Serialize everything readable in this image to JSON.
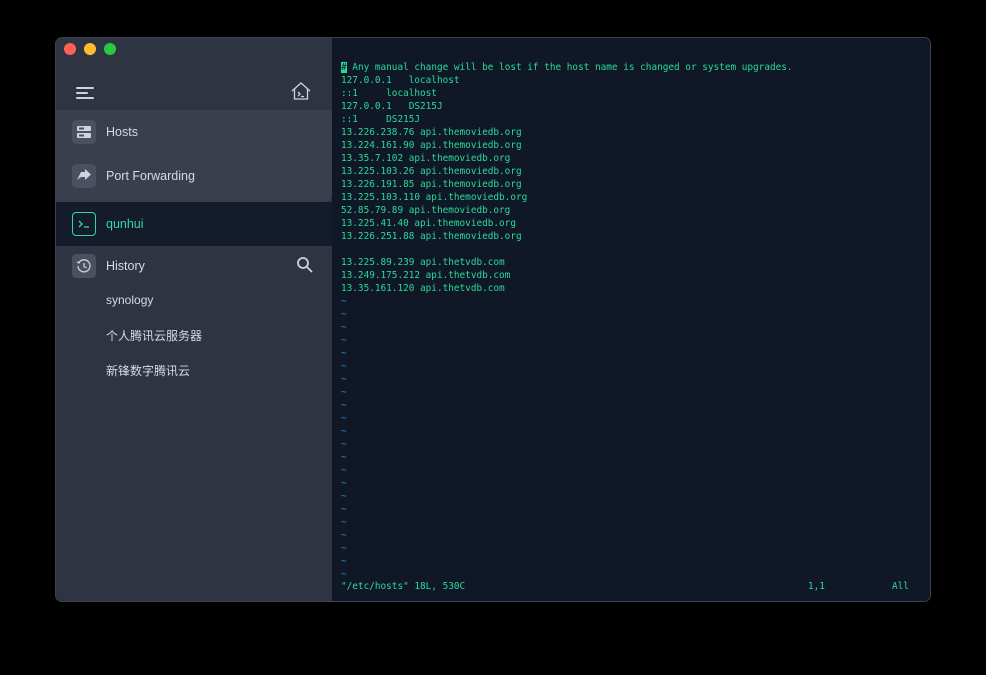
{
  "sidebar": {
    "nav": [
      {
        "label": "Hosts",
        "icon": "server-icon"
      },
      {
        "label": "Port Forwarding",
        "icon": "forward-arrow-icon"
      }
    ],
    "active_session": {
      "label": "qunhui",
      "icon": "terminal-prompt-icon"
    },
    "history": {
      "label": "History",
      "icon": "history-clock-icon",
      "entries": [
        "synology",
        "个人腾讯云服务器",
        "新锋数字腾讯云"
      ]
    }
  },
  "terminal": {
    "first_line_cursor": "#",
    "first_line_rest": " Any manual change will be lost if the host name is changed or system upgrades.",
    "lines": [
      "127.0.0.1   localhost",
      "::1     localhost",
      "127.0.0.1   DS215J",
      "::1     DS215J",
      "13.226.238.76 api.themoviedb.org",
      "13.224.161.90 api.themoviedb.org",
      "13.35.7.102 api.themoviedb.org",
      "13.225.103.26 api.themoviedb.org",
      "13.226.191.85 api.themoviedb.org",
      "13.225.103.110 api.themoviedb.org",
      "52.85.79.89 api.themoviedb.org",
      "13.225.41.40 api.themoviedb.org",
      "13.226.251.88 api.themoviedb.org",
      "",
      "13.225.89.239 api.thetvdb.com",
      "13.249.175.212 api.thetvdb.com",
      "13.35.161.120 api.thetvdb.com"
    ],
    "tilde_char": "~",
    "tilde_count": 22,
    "status_file": "\"/etc/hosts\" 18L, 530C",
    "status_position": "1,1",
    "status_scroll": "All"
  },
  "colors": {
    "terminal_bg": "#101726",
    "terminal_text": "#28dc98",
    "tilde": "#2a8bd1",
    "sidebar_bg": "#2f3443",
    "accent": "#30d8a3"
  }
}
